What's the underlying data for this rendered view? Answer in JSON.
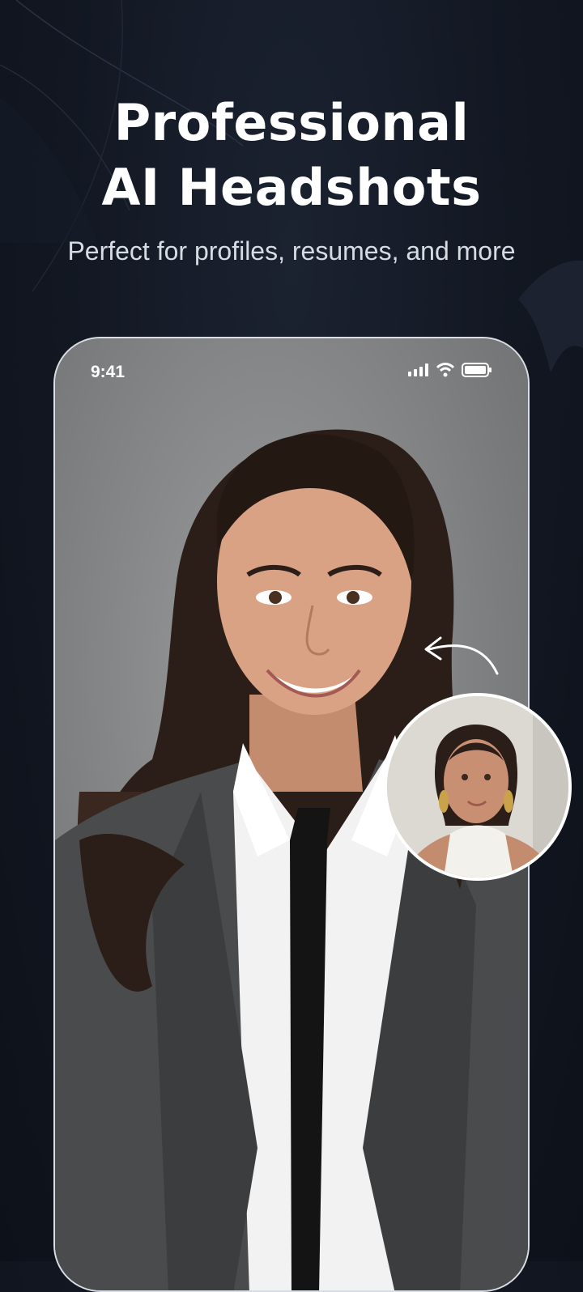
{
  "hero": {
    "title_line1": "Professional",
    "title_line2": "AI Headshots",
    "subtitle": "Perfect for profiles, resumes, and more"
  },
  "phone": {
    "status_time": "9:41",
    "status_icons": [
      "signal-icon",
      "wifi-icon",
      "battery-icon"
    ]
  },
  "images": {
    "main": "ai-generated professional headshot of woman in suit and tie",
    "inset": "original selfie of woman in sleeveless top"
  },
  "colors": {
    "background": "#121722",
    "frame_border": "#d9dde6",
    "text": "#ffffff"
  }
}
